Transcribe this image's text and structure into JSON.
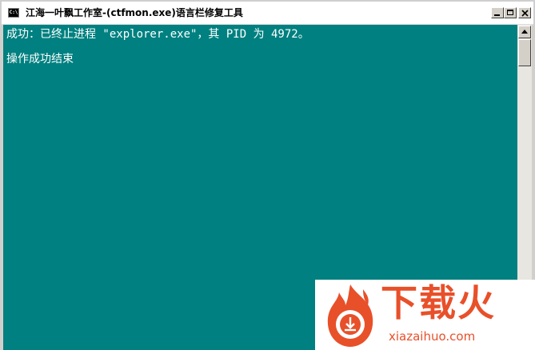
{
  "window": {
    "title": "江海一叶飘工作室-(ctfmon.exe)语言栏修复工具",
    "icon": "console-icon",
    "icon_text": "C:\\"
  },
  "console": {
    "lines": [
      "成功：已终止进程 \"explorer.exe\"，其 PID 为 4972。",
      "操作成功结束"
    ],
    "background_color": "#008080",
    "text_color": "#ffffff"
  },
  "watermark": {
    "name": "下载火",
    "url": "xiazaihuo.com",
    "color": "#e8502a"
  }
}
